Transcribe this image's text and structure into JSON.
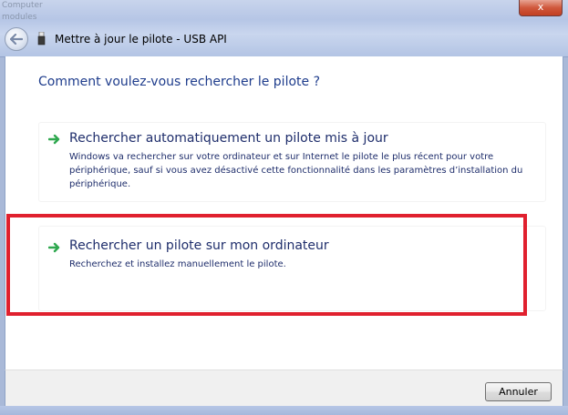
{
  "window": {
    "title": "Mettre à jour le pilote - USB API",
    "close_label": "x",
    "background_text": [
      "Computer",
      "modules"
    ]
  },
  "main": {
    "question": "Comment voulez-vous rechercher le pilote ?",
    "options": [
      {
        "title": "Rechercher automatiquement un pilote mis à jour",
        "description": "Windows va rechercher sur votre ordinateur et sur Internet le pilote le plus récent pour votre périphérique, sauf si vous avez désactivé cette fonctionnalité dans les paramètres d’installation du périphérique.",
        "icon": "green-arrow-icon"
      },
      {
        "title": "Rechercher un pilote sur mon ordinateur",
        "description": "Recherchez et installez manuellement le pilote.",
        "icon": "green-arrow-icon",
        "highlighted": true
      }
    ]
  },
  "footer": {
    "cancel_label": "Annuler"
  },
  "colors": {
    "heading": "#1e3c8c",
    "option_text": "#1e2d6b",
    "highlight_border": "#e0202e",
    "arrow": "#2fa84f"
  }
}
